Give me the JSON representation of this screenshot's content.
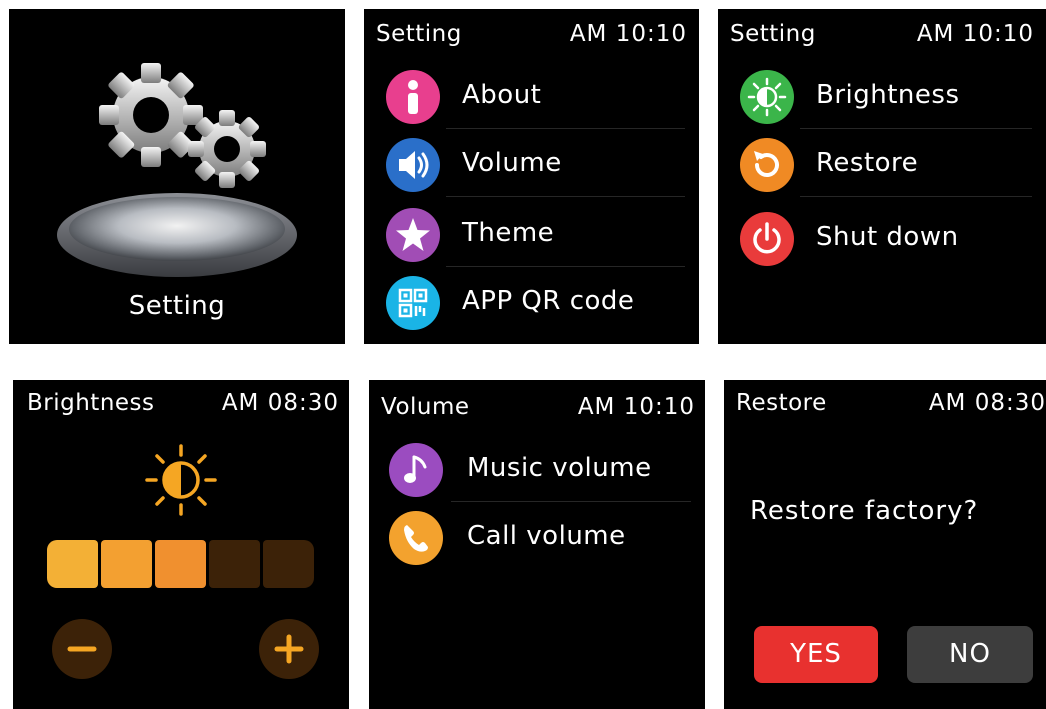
{
  "panel_home": {
    "label": "Setting"
  },
  "panel_menu1": {
    "title": "Setting",
    "time": "AM 10:10",
    "items": [
      {
        "label": "About",
        "icon": "info-icon",
        "color": "#e83f8e"
      },
      {
        "label": "Volume",
        "icon": "speaker-icon",
        "color": "#2a6fc9"
      },
      {
        "label": "Theme",
        "icon": "star-icon",
        "color": "#a14db5"
      },
      {
        "label": "APP QR code",
        "icon": "qr-code-icon",
        "color": "#1ab4e6"
      }
    ]
  },
  "panel_menu2": {
    "title": "Setting",
    "time": "AM 10:10",
    "items": [
      {
        "label": "Brightness",
        "icon": "brightness-icon",
        "color": "#3bb54a"
      },
      {
        "label": "Restore",
        "icon": "restore-icon",
        "color": "#f08a24"
      },
      {
        "label": "Shut down",
        "icon": "power-icon",
        "color": "#e93b3b"
      }
    ]
  },
  "panel_brightness": {
    "title": "Brightness",
    "time": "AM 08:30",
    "level": 3,
    "max_level": 5,
    "accent": "#f5a623",
    "minus_icon": "minus-icon",
    "plus_icon": "plus-icon"
  },
  "panel_volume": {
    "title": "Volume",
    "time": "AM 10:10",
    "items": [
      {
        "label": "Music volume",
        "icon": "music-note-icon",
        "color": "#9b4cc0"
      },
      {
        "label": "Call volume",
        "icon": "phone-icon",
        "color": "#f3a22e"
      }
    ]
  },
  "panel_restore": {
    "title": "Restore",
    "time": "AM 08:30",
    "question": "Restore factory?",
    "yes_label": "YES",
    "no_label": "NO",
    "yes_color": "#e8312f",
    "no_color": "#3d3d3d"
  }
}
